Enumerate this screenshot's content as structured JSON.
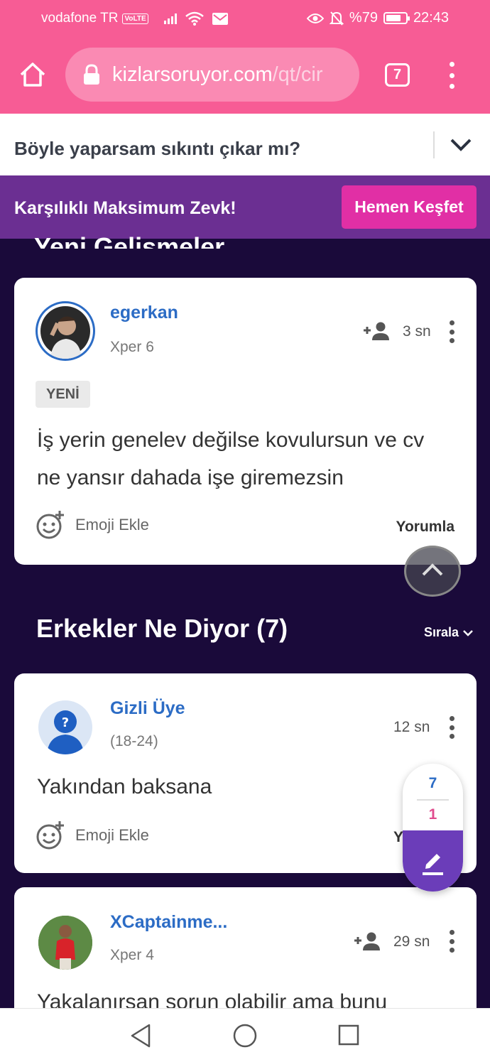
{
  "status_bar": {
    "carrier": "vodafone TR",
    "volte": "VoLTE",
    "battery": "%79",
    "time": "22:43",
    "battery_level": 0.79
  },
  "browser": {
    "url_domain": "kizlarsoruyor.com",
    "url_path": "/qt/cir",
    "tab_count": "7"
  },
  "question": {
    "title": "Böyle yaparsam sıkıntı çıkar mı?"
  },
  "promo": {
    "text": "Karşılıklı Maksimum Zevk!",
    "button": "Hemen Keşfet"
  },
  "section_cut_title": "Yeni Gelişmeler",
  "latest_post": {
    "username": "egerkan",
    "level": "Xper 6",
    "time": "3 sn",
    "badge": "YENİ",
    "text_line1": "İş yerin genelev değilse kovulursun ve cv",
    "text_line2": "ne yansır dahada işe giremezsin",
    "emoji_label": "Emoji Ekle",
    "reply_label": "Yorumla"
  },
  "section": {
    "title": "Erkekler Ne Diyor (7)",
    "sort_label": "Sırala"
  },
  "answers": [
    {
      "username": "Gizli Üye",
      "subtitle": "(18-24)",
      "time": "12 sn",
      "text": "Yakından baksana",
      "emoji_label": "Emoji Ekle",
      "reply_label": "Y"
    },
    {
      "username": "XCaptainme...",
      "subtitle": "Xper 4",
      "time": "29 sn",
      "text": "Yakalanırsan sorun olabilir ama bunu"
    }
  ],
  "floater": {
    "count_top": "7",
    "count_bottom": "1"
  }
}
